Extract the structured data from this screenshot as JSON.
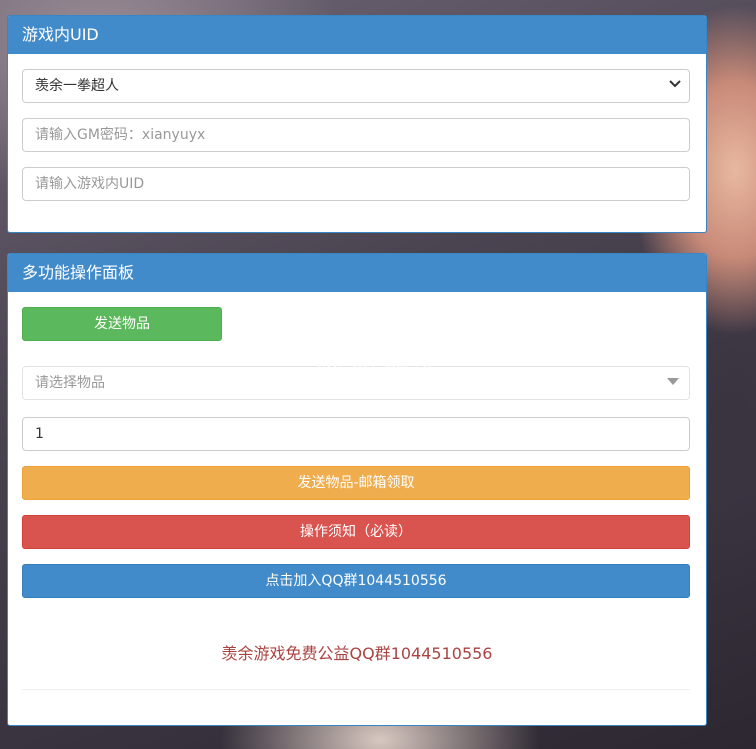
{
  "panel_uid": {
    "title": "游戏内UID",
    "server_select": {
      "value": "羡余一拳超人"
    },
    "gm_password": {
      "placeholder": "请输入GM密码：xianyuyx"
    },
    "uid_input": {
      "placeholder": "请输入游戏内UID"
    }
  },
  "panel_ops": {
    "title": "多功能操作面板",
    "send_items_button": "发送物品",
    "item_select": {
      "placeholder": "请选择物品"
    },
    "quantity": {
      "value": "1"
    },
    "send_mail_button": "发送物品-邮箱领取",
    "notice_button": "操作须知（必读）",
    "join_group_button": "点击加入QQ群1044510556",
    "footer_note": "羡余游戏免费公益QQ群1044510556"
  },
  "watermark": {
    "main": "K73",
    "sub": "游戏之家",
    "domain": ".com"
  },
  "colors": {
    "primary": "#428bca",
    "success": "#5cb85c",
    "warning": "#f0ad4e",
    "danger": "#d9534f",
    "footer_text": "#a94442"
  },
  "icons": {
    "select_caret": "chevron-down-icon",
    "dropdown_caret": "caret-down-icon"
  }
}
